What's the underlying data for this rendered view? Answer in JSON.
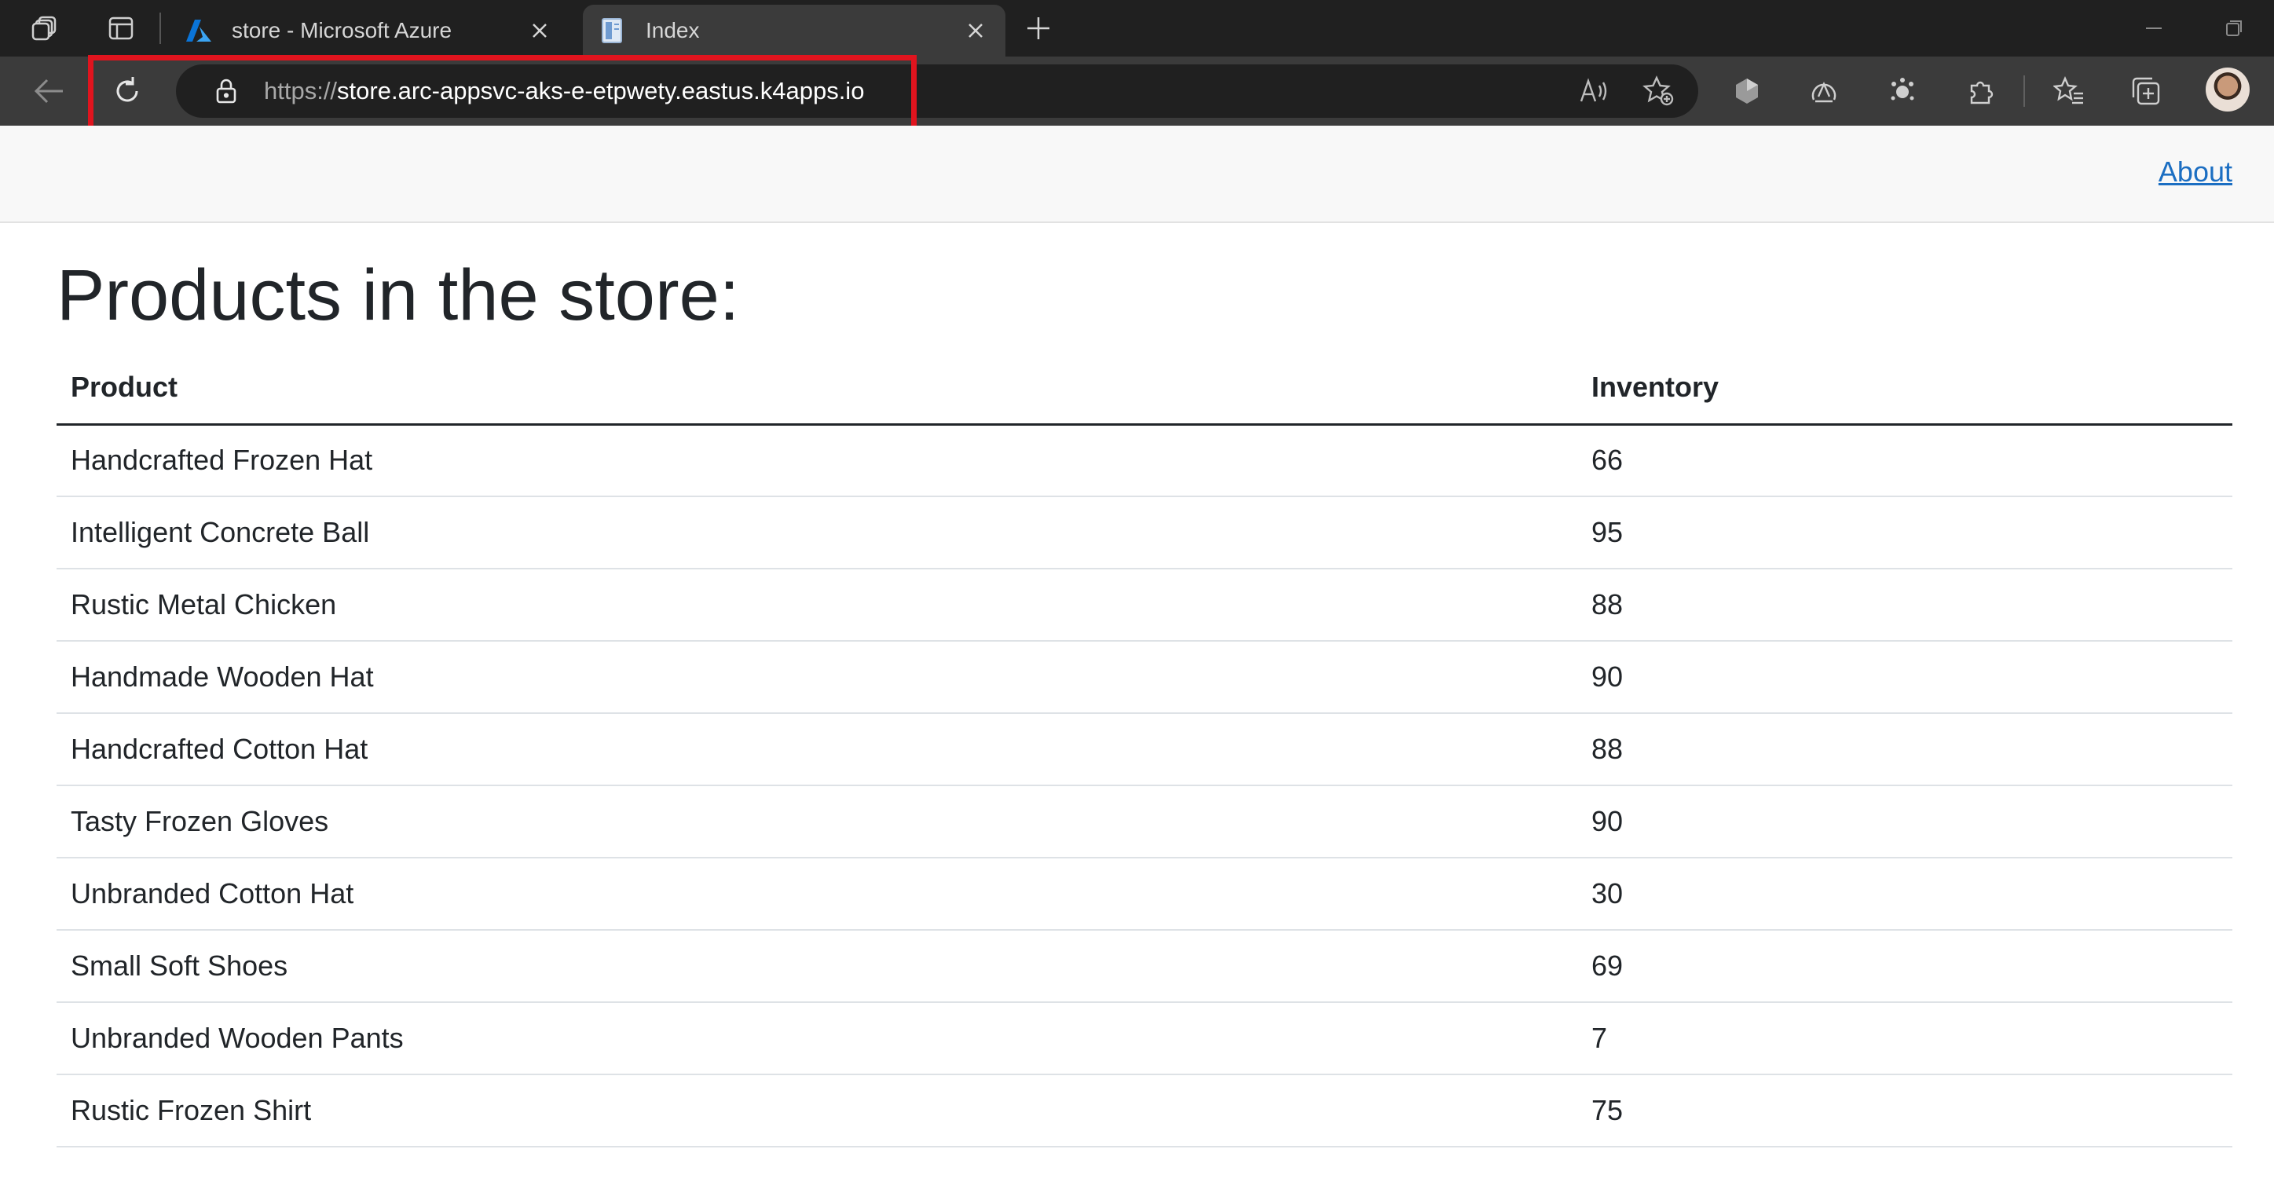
{
  "browser": {
    "tabs": [
      {
        "title": "store - Microsoft Azure",
        "icon": "azure-logo-icon",
        "active": false
      },
      {
        "title": "Index",
        "icon": "page-icon",
        "active": true
      }
    ],
    "address_bar": {
      "scheme": "https://",
      "host_path": "store.arc-appsvc-aks-e-etpwety.eastus.k4apps.io"
    },
    "accent_colors": {
      "highlight_box": "#e0141e",
      "link": "#1b6ec2"
    }
  },
  "navbar": {
    "about_label": "About"
  },
  "main": {
    "title": "Products in the store:",
    "table": {
      "headers": [
        "Product",
        "Inventory"
      ],
      "rows": [
        [
          "Handcrafted Frozen Hat",
          "66"
        ],
        [
          "Intelligent Concrete Ball",
          "95"
        ],
        [
          "Rustic Metal Chicken",
          "88"
        ],
        [
          "Handmade Wooden Hat",
          "90"
        ],
        [
          "Handcrafted Cotton Hat",
          "88"
        ],
        [
          "Tasty Frozen Gloves",
          "90"
        ],
        [
          "Unbranded Cotton Hat",
          "30"
        ],
        [
          "Small Soft Shoes",
          "69"
        ],
        [
          "Unbranded Wooden Pants",
          "7"
        ],
        [
          "Rustic Frozen Shirt",
          "75"
        ]
      ]
    }
  }
}
